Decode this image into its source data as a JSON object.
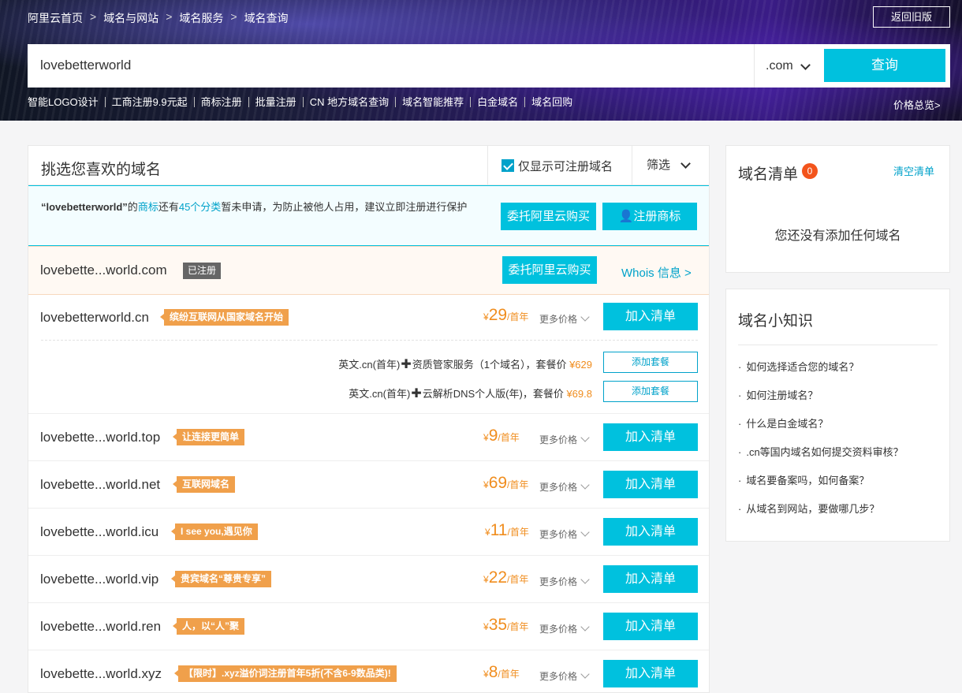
{
  "breadcrumb": [
    "阿里云首页",
    "域名与网站",
    "域名服务",
    "域名查询"
  ],
  "breadcrumb_sep": ">",
  "old_version_label": "返回旧版",
  "search": {
    "value": "lovebetterworld",
    "tld": ".com",
    "button_label": "查询"
  },
  "quick_links": [
    "智能LOGO设计",
    "工商注册9.9元起",
    "商标注册",
    "批量注册",
    "CN 地方域名查询",
    "域名智能推荐",
    "白金域名",
    "域名回购"
  ],
  "price_overview": "价格总览>",
  "main": {
    "title": "挑选您喜欢的域名",
    "only_available_label": "仅显示可注册域名",
    "filter_label": "筛选"
  },
  "trademark": {
    "quote": "“lovebetterworld”",
    "t1": "的",
    "link1": "商标",
    "t2": "还有",
    "link2": "45个分类",
    "t3": "暂未申请，为防止被他人占用，建议立即注册进行保护",
    "buy_label": "委托阿里云购买",
    "register_label": "注册商标"
  },
  "registered": {
    "domain": "lovebette...world.com",
    "tag": "已注册",
    "buy_label": "委托阿里云购买",
    "whois_label": "Whois 信息 >"
  },
  "common": {
    "yen": "¥",
    "per_year": "/首年",
    "more_price": "更多价格",
    "add_label": "加入清单",
    "add_bundle": "添加套餐"
  },
  "cn_row": {
    "domain": "lovebetterworld.cn",
    "tag": "缤纷互联网从国家域名开始",
    "price": "29",
    "bundles": [
      {
        "left": "英文.cn(首年)",
        "plus": "✚",
        "right": "资质管家服务（1个域名），套餐价",
        "price": "¥629"
      },
      {
        "left": "英文.cn(首年)",
        "plus": "✚",
        "right": "云解析DNS个人版(年)，套餐价",
        "price": "¥69.8"
      }
    ]
  },
  "domains": [
    {
      "domain": "lovebette...world.top",
      "tag": "让连接更简单",
      "price": "9"
    },
    {
      "domain": "lovebette...world.net",
      "tag": "互联网域名",
      "price": "69"
    },
    {
      "domain": "lovebette...world.icu",
      "tag": "I see you,遇见你",
      "price": "11"
    },
    {
      "domain": "lovebette...world.vip",
      "tag": "贵宾域名“尊贵专享”",
      "price": "22"
    },
    {
      "domain": "lovebette...world.ren",
      "tag": "人，以“人”聚",
      "price": "35"
    },
    {
      "domain": "lovebette...world.xyz",
      "tag": "【限时】.xyz溢价词注册首年5折(不含6-9数品类)!",
      "price": "8"
    }
  ],
  "cart": {
    "title": "域名清单",
    "count": "0",
    "clear_label": "清空清单",
    "empty_text": "您还没有添加任何域名"
  },
  "knowledge": {
    "title": "域名小知识",
    "items": [
      "如何选择适合您的域名？",
      "如何注册域名？",
      "什么是白金域名？",
      ".cn等国内域名如何提交资料审核？",
      "域名要备案吗，如何备案？",
      "从域名到网站，要做哪几步？"
    ]
  },
  "colors": {
    "accent": "#00c1de",
    "link": "#00a2ca",
    "price": "#f08d1e",
    "tag": "#f0a04b",
    "badge": "#f3541c"
  }
}
